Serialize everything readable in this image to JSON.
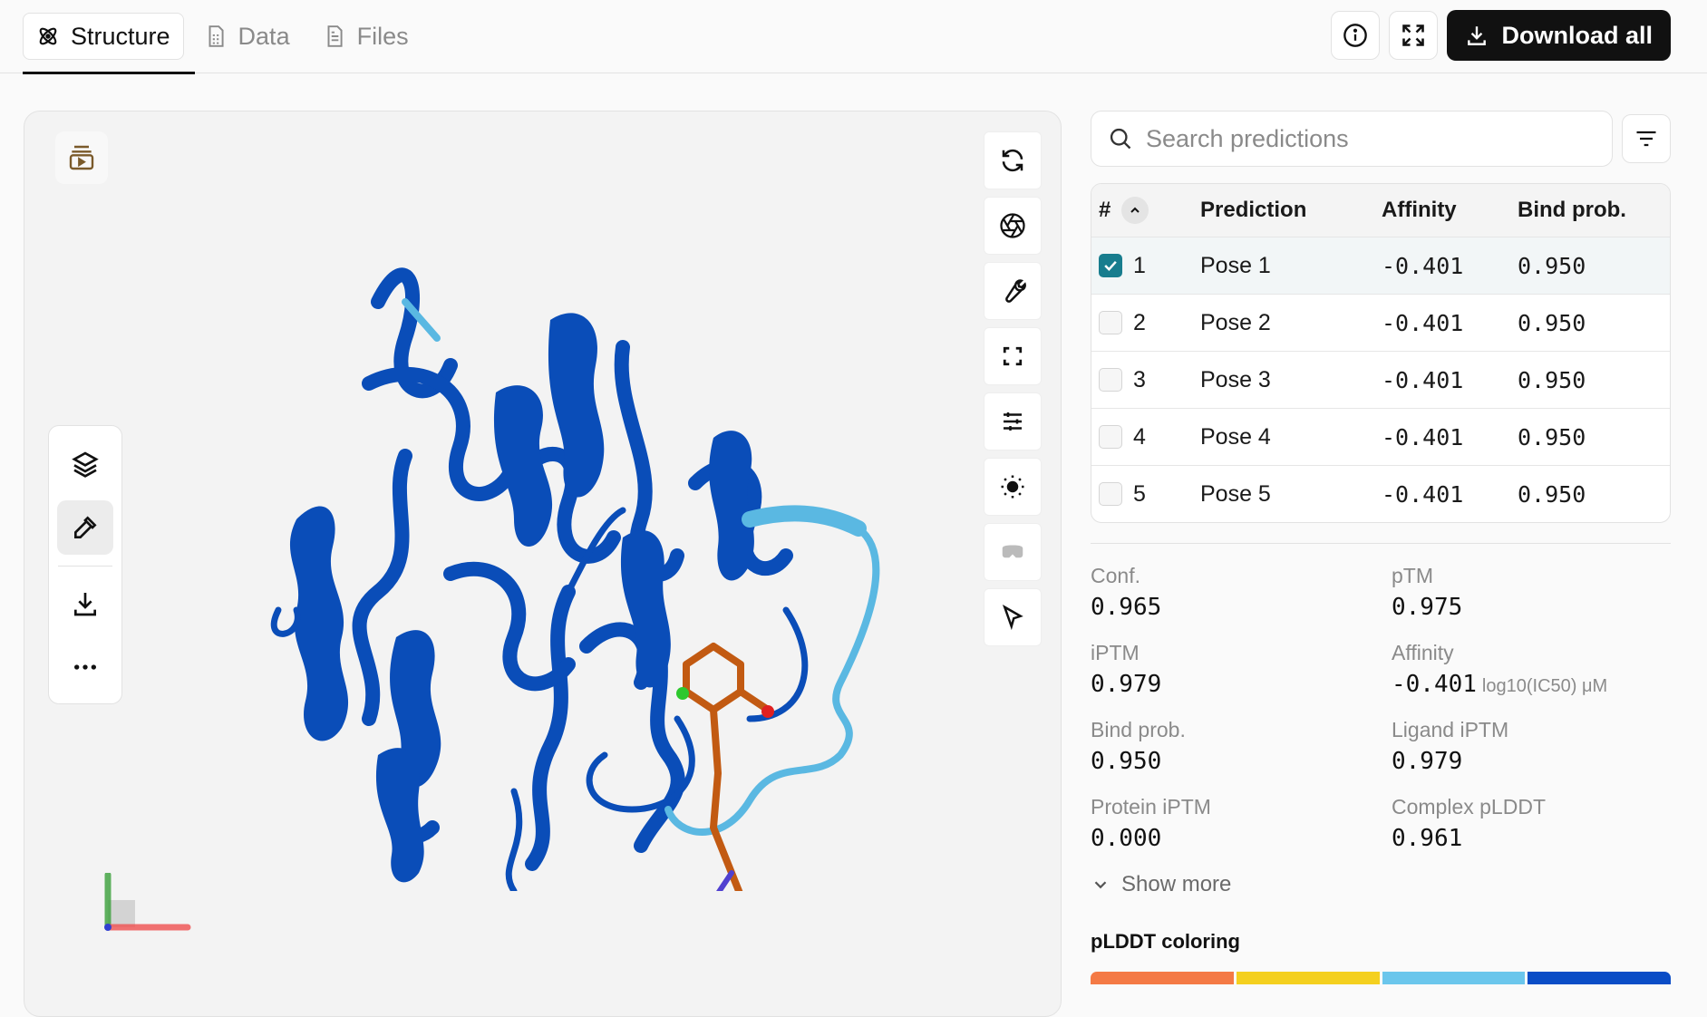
{
  "tabs": [
    {
      "label": "Structure",
      "icon": "atom-icon",
      "active": true
    },
    {
      "label": "Data",
      "icon": "data-file-icon",
      "active": false
    },
    {
      "label": "Files",
      "icon": "file-icon",
      "active": false
    }
  ],
  "toolbar": {
    "download_label": "Download all",
    "info_icon": "info-icon",
    "fullscreen_icon": "fullscreen-icon"
  },
  "search": {
    "placeholder": "Search predictions"
  },
  "table": {
    "headers": {
      "idx": "#",
      "prediction": "Prediction",
      "affinity": "Affinity",
      "bind_prob": "Bind prob."
    },
    "rows": [
      {
        "idx": "1",
        "prediction": "Pose 1",
        "affinity": "-0.401",
        "bind_prob": "0.950",
        "checked": true
      },
      {
        "idx": "2",
        "prediction": "Pose 2",
        "affinity": "-0.401",
        "bind_prob": "0.950",
        "checked": false
      },
      {
        "idx": "3",
        "prediction": "Pose 3",
        "affinity": "-0.401",
        "bind_prob": "0.950",
        "checked": false
      },
      {
        "idx": "4",
        "prediction": "Pose 4",
        "affinity": "-0.401",
        "bind_prob": "0.950",
        "checked": false
      },
      {
        "idx": "5",
        "prediction": "Pose 5",
        "affinity": "-0.401",
        "bind_prob": "0.950",
        "checked": false
      }
    ]
  },
  "metrics": {
    "conf": {
      "label": "Conf.",
      "value": "0.965"
    },
    "ptm": {
      "label": "pTM",
      "value": "0.975"
    },
    "iptm": {
      "label": "iPTM",
      "value": "0.979"
    },
    "affinity": {
      "label": "Affinity",
      "value": "-0.401",
      "unit": "log10(IC50) μM"
    },
    "bind_prob": {
      "label": "Bind prob.",
      "value": "0.950"
    },
    "ligand_iptm": {
      "label": "Ligand iPTM",
      "value": "0.979"
    },
    "protein_iptm": {
      "label": "Protein iPTM",
      "value": "0.000"
    },
    "complex_plddt": {
      "label": "Complex pLDDT",
      "value": "0.961"
    }
  },
  "show_more": "Show more",
  "plddt": {
    "title": "pLDDT coloring",
    "colors": [
      "#f47a45",
      "#f4d01f",
      "#6bc6ec",
      "#0a4dc6"
    ]
  },
  "colors": {
    "accent": "#187d8e",
    "protein": "#0a4db8",
    "protein_light": "#5ab8e2",
    "ligand": "#c25a12"
  }
}
